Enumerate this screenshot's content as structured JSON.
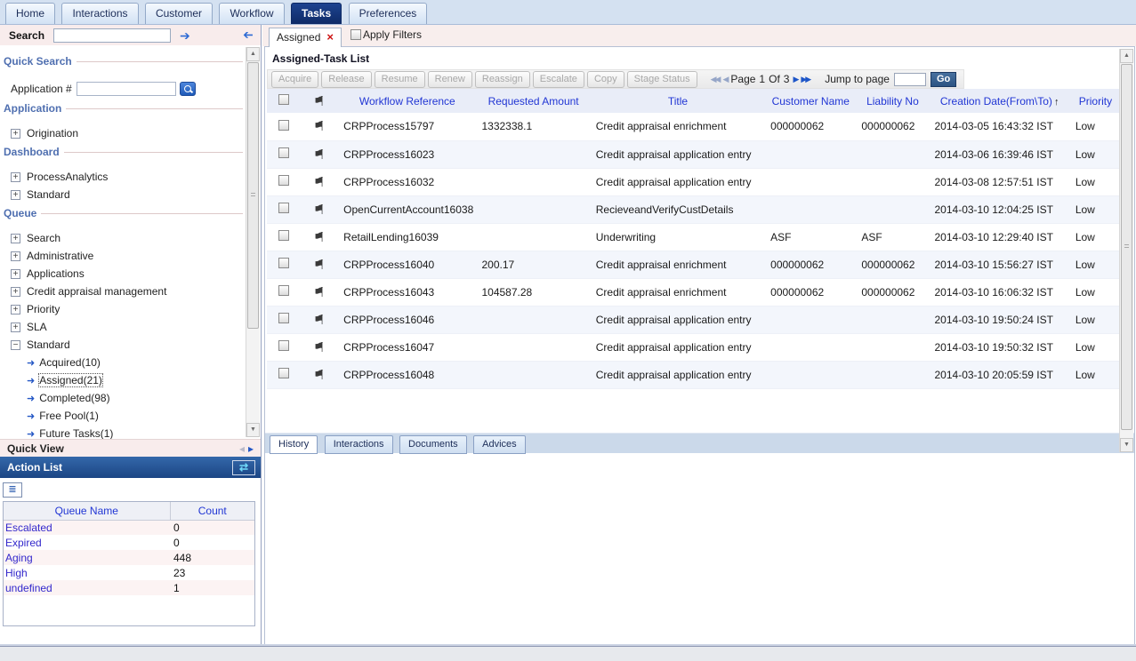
{
  "icons": {
    "flag": "⚑",
    "close": "×",
    "sort_asc": "↑",
    "forward_arrow": "➔",
    "back_arrow": "➔",
    "leaf_arrow": "➜",
    "refresh": "⇄",
    "list_view": "≣",
    "prev_page": "◀◀",
    "prev_one": "◀",
    "next_one": "▶",
    "next_page": "▶▶",
    "scroll_up": "▲",
    "scroll_down": "▼",
    "expand": "+",
    "collapse": "−",
    "quickview_left": "◂",
    "quickview_right": "▸"
  },
  "top_tabs": [
    "Home",
    "Interactions",
    "Customer",
    "Workflow",
    "Tasks",
    "Preferences"
  ],
  "sidebar": {
    "search_label": "Search",
    "sections": {
      "quick_search": "Quick Search",
      "application": "Application",
      "dashboard": "Dashboard",
      "queue": "Queue",
      "quick_view": "Quick View",
      "action_list": "Action List"
    },
    "application_number_label": "Application #",
    "application_items": [
      "Origination"
    ],
    "dashboard_items": [
      "ProcessAnalytics",
      "Standard"
    ],
    "queue_items": [
      "Search",
      "Administrative",
      "Applications",
      "Credit appraisal management",
      "Priority",
      "SLA",
      "Standard"
    ],
    "standard_children": [
      "Acquired(10)",
      "Assigned(21)",
      "Completed(98)",
      "Free Pool(1)",
      "Future Tasks(1)"
    ],
    "action_list": {
      "headers": [
        "Queue Name",
        "Count"
      ],
      "rows": [
        [
          "Escalated",
          "0"
        ],
        [
          "Expired",
          "0"
        ],
        [
          "Aging",
          "448"
        ],
        [
          "High",
          "23"
        ],
        [
          "undefined",
          "1"
        ]
      ]
    }
  },
  "main": {
    "task_tab": "Assigned",
    "apply_filters": "Apply Filters",
    "title": "Assigned-Task List",
    "toolbar_buttons": [
      "Acquire",
      "Release",
      "Resume",
      "Renew",
      "Reassign",
      "Escalate",
      "Copy",
      "Stage Status"
    ],
    "pagination": {
      "page_label": "Page",
      "current": "1",
      "of_label": "Of",
      "total": "3",
      "jump_label": "Jump to page",
      "go": "Go"
    },
    "table": {
      "headers": [
        "Workflow Reference",
        "Requested Amount",
        "Title",
        "Customer Name",
        "Liability No",
        "Creation Date(From\\To)",
        "Priority"
      ],
      "sorted_by": "Creation Date(From\\To) ascending",
      "rows": [
        [
          "CRPProcess15797",
          "1332338.1",
          "Credit appraisal enrichment",
          "000000062",
          "000000062",
          "2014-03-05 16:43:32 IST",
          "Low"
        ],
        [
          "CRPProcess16023",
          "",
          "Credit appraisal application entry",
          "",
          "",
          "2014-03-06 16:39:46 IST",
          "Low"
        ],
        [
          "CRPProcess16032",
          "",
          "Credit appraisal application entry",
          "",
          "",
          "2014-03-08 12:57:51 IST",
          "Low"
        ],
        [
          "OpenCurrentAccount16038",
          "",
          "RecieveandVerifyCustDetails",
          "",
          "",
          "2014-03-10 12:04:25 IST",
          "Low"
        ],
        [
          "RetailLending16039",
          "",
          "Underwriting",
          "ASF",
          "ASF",
          "2014-03-10 12:29:40 IST",
          "Low"
        ],
        [
          "CRPProcess16040",
          "200.17",
          "Credit appraisal enrichment",
          "000000062",
          "000000062",
          "2014-03-10 15:56:27 IST",
          "Low"
        ],
        [
          "CRPProcess16043",
          "104587.28",
          "Credit appraisal enrichment",
          "000000062",
          "000000062",
          "2014-03-10 16:06:32 IST",
          "Low"
        ],
        [
          "CRPProcess16046",
          "",
          "Credit appraisal application entry",
          "",
          "",
          "2014-03-10 19:50:24 IST",
          "Low"
        ],
        [
          "CRPProcess16047",
          "",
          "Credit appraisal application entry",
          "",
          "",
          "2014-03-10 19:50:32 IST",
          "Low"
        ],
        [
          "CRPProcess16048",
          "",
          "Credit appraisal application entry",
          "",
          "",
          "2014-03-10 20:05:59 IST",
          "Low"
        ]
      ]
    },
    "bottom_tabs": [
      "History",
      "Interactions",
      "Documents",
      "Advices"
    ]
  },
  "colors": {
    "active_tab_navy": "#12377e",
    "panel_header_blue": "#1d4c8f",
    "column_link_blue": "#2136d4",
    "pink_bar": "#f8ecec",
    "close_red": "#cc1111",
    "accent_arrow_blue": "#2e6bd4"
  }
}
